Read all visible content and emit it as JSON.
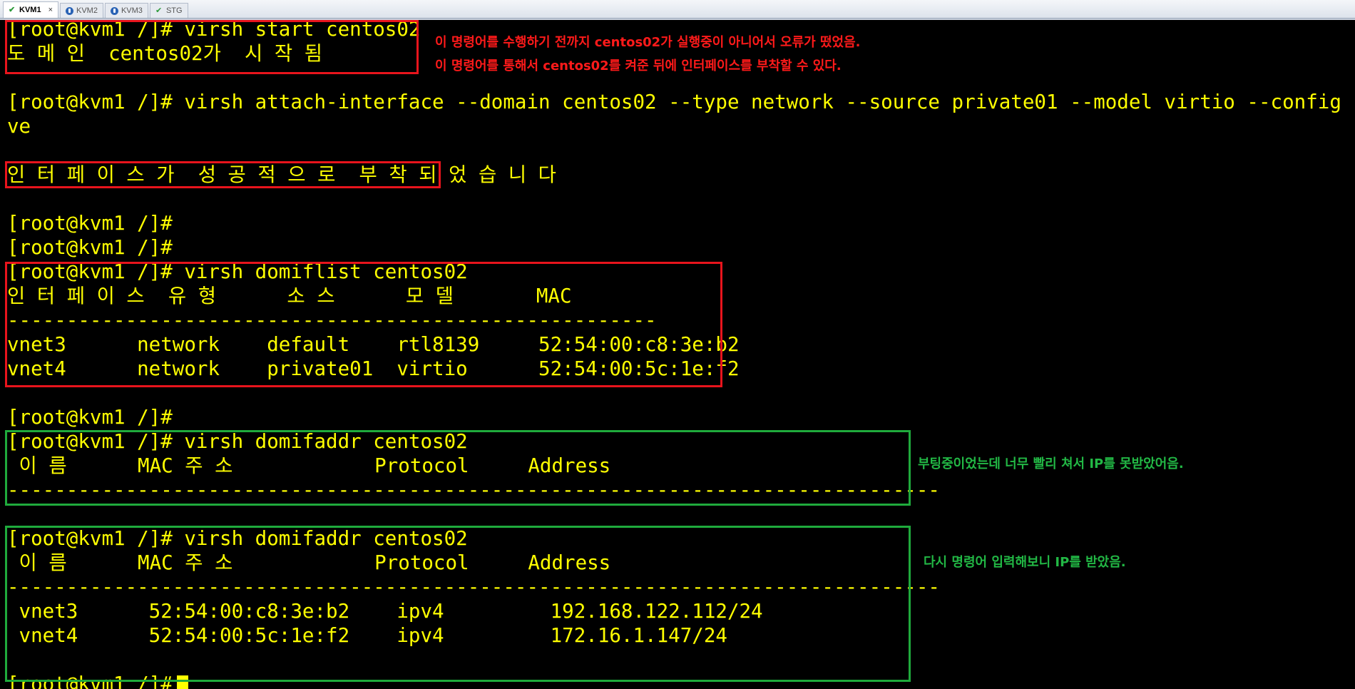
{
  "tabs": [
    {
      "label": "KVM1",
      "active": true,
      "icon": "check-icon",
      "close": "×"
    },
    {
      "label": "KVM2",
      "active": false,
      "icon": "status-icon"
    },
    {
      "label": "KVM3",
      "active": false,
      "icon": "status-icon"
    },
    {
      "label": "STG",
      "active": false,
      "icon": "check-icon"
    }
  ],
  "terminal": {
    "lines": [
      "[root@kvm1 /]# virsh start centos02",
      "도 메 인  centos02가  시 작 됨",
      "",
      "[root@kvm1 /]# virsh attach-interface --domain centos02 --type network --source private01 --model virtio --config --li",
      "ve",
      "",
      "인 터 페 이 스 가  성 공 적 으 로  부 착 되 었 습 니 다",
      "",
      "[root@kvm1 /]#",
      "[root@kvm1 /]#",
      "[root@kvm1 /]# virsh domiflist centos02",
      "인 터 페 이 스  유 형      소 스      모 델       MAC",
      "-------------------------------------------------------",
      "vnet3      network    default    rtl8139     52:54:00:c8:3e:b2",
      "vnet4      network    private01  virtio      52:54:00:5c:1e:f2",
      "",
      "[root@kvm1 /]#",
      "[root@kvm1 /]# virsh domifaddr centos02",
      " 이 름      MAC 주 소            Protocol     Address",
      "-------------------------------------------------------------------------------",
      "",
      "[root@kvm1 /]# virsh domifaddr centos02",
      " 이 름      MAC 주 소            Protocol     Address",
      "-------------------------------------------------------------------------------",
      " vnet3      52:54:00:c8:3e:b2    ipv4         192.168.122.112/24",
      " vnet4      52:54:00:5c:1e:f2    ipv4         172.16.1.147/24",
      "",
      "[root@kvm1 /]# "
    ]
  },
  "annotations": {
    "start_note_1": "이 명령어를 수행하기 전까지 centos02가 실행중이 아니어서 오류가 떴었음.",
    "start_note_2": "이 명령어를 통해서 centos02를 켜준 뒤에 인터페이스를 부착할 수 있다.",
    "domifaddr_note_1": "부팅중이었는데 너무 빨리 쳐서 IP를 못받았어음.",
    "domifaddr_note_2": "다시 명령어 입력해보니 IP를 받았음."
  },
  "colors": {
    "terminal_text": "#ffff00",
    "terminal_bg": "#000000",
    "red_highlight": "#e8141c",
    "green_highlight": "#1faa3c"
  }
}
